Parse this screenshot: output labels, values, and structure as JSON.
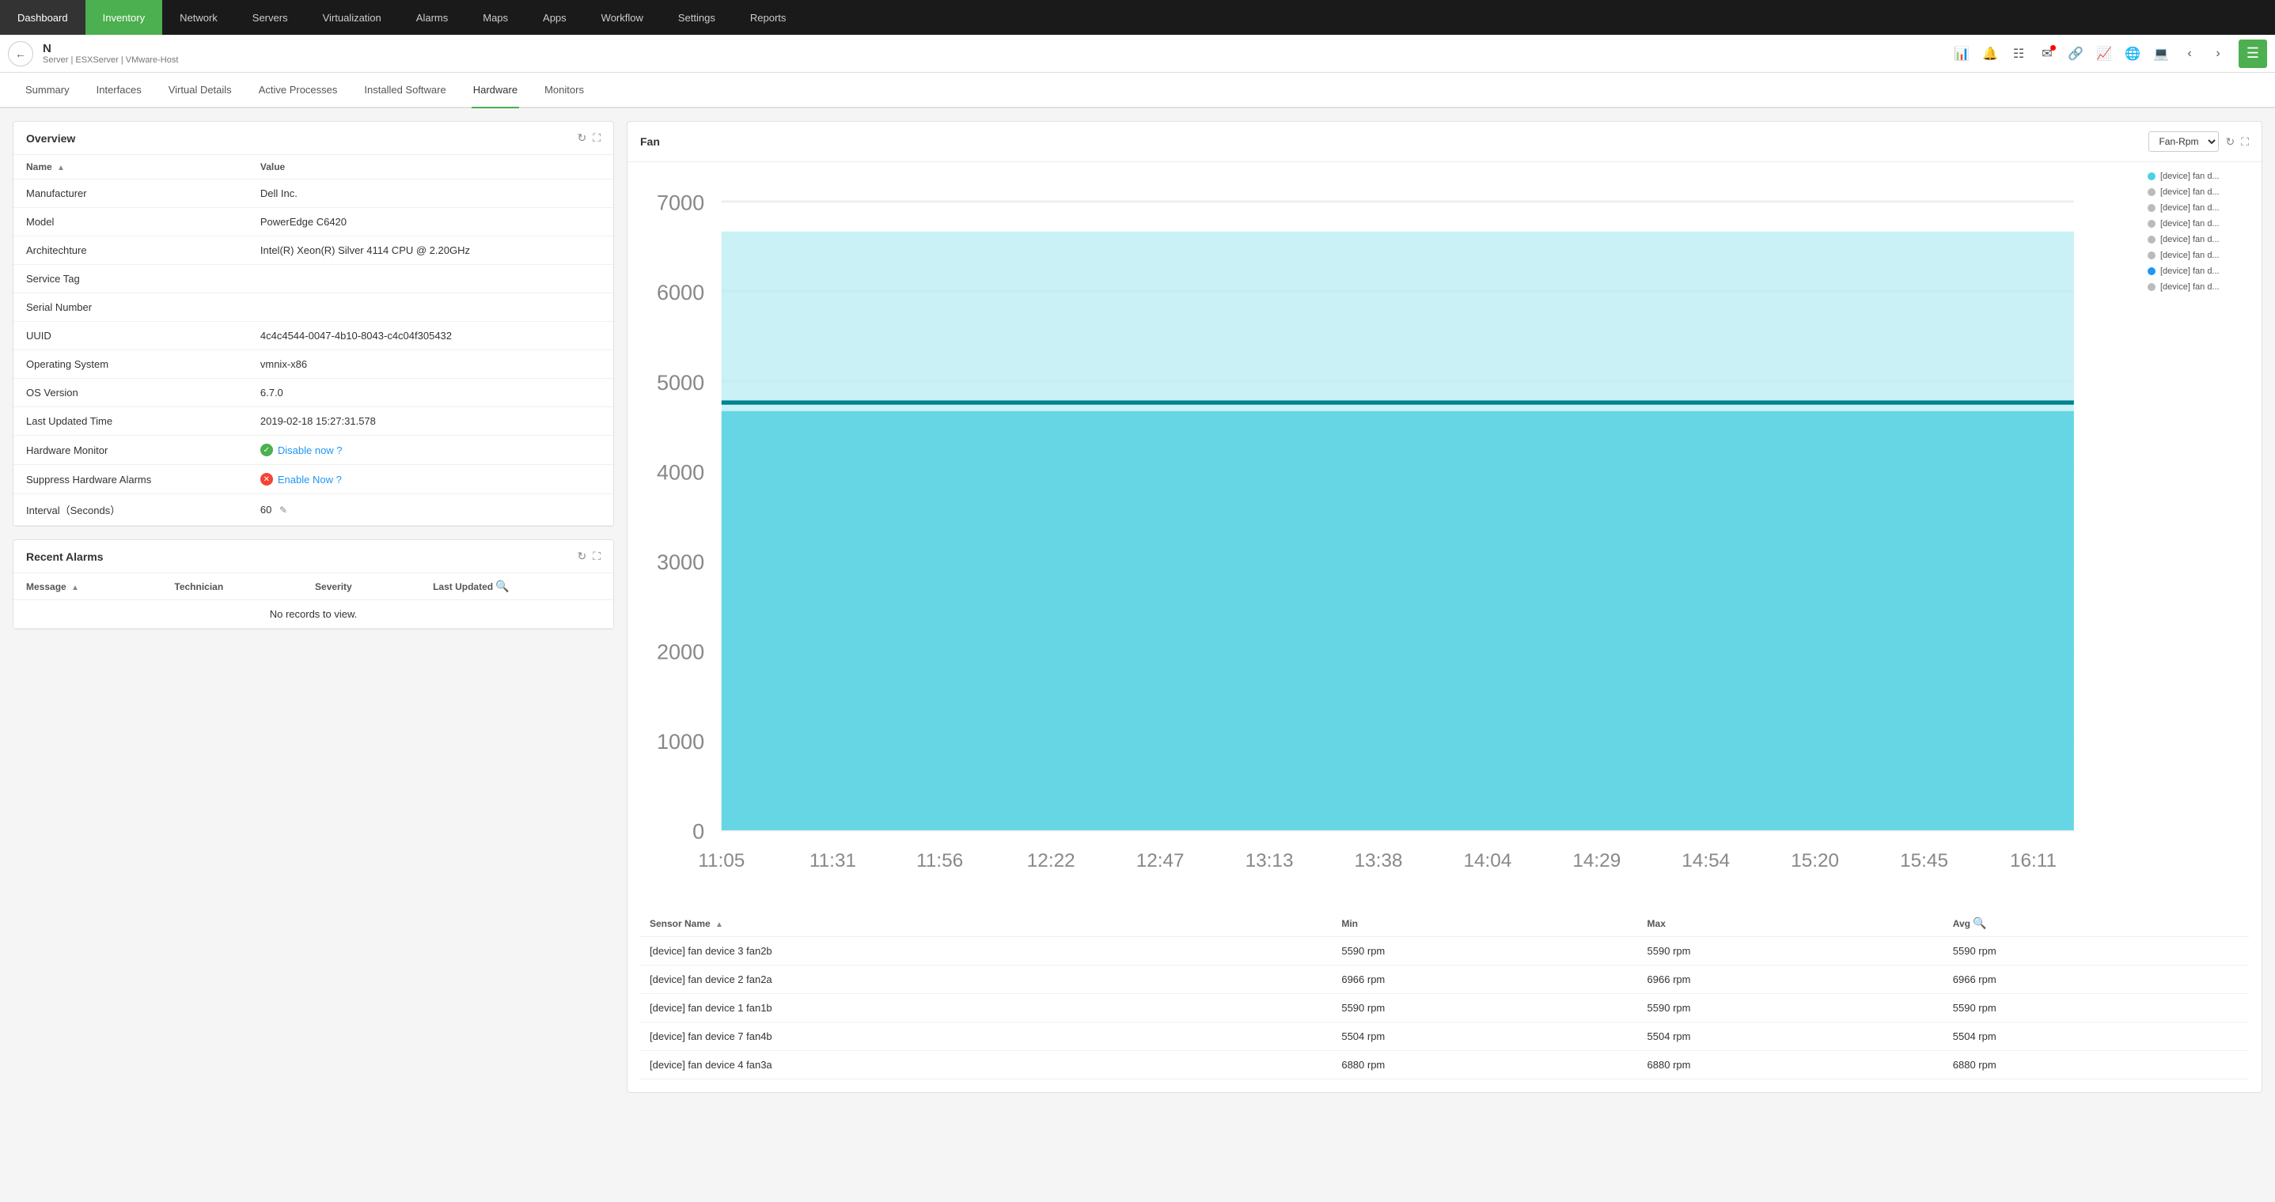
{
  "topNav": {
    "items": [
      {
        "label": "Dashboard",
        "active": false
      },
      {
        "label": "Inventory",
        "active": true
      },
      {
        "label": "Network",
        "active": false
      },
      {
        "label": "Servers",
        "active": false
      },
      {
        "label": "Virtualization",
        "active": false
      },
      {
        "label": "Alarms",
        "active": false
      },
      {
        "label": "Maps",
        "active": false
      },
      {
        "label": "Apps",
        "active": false
      },
      {
        "label": "Workflow",
        "active": false
      },
      {
        "label": "Settings",
        "active": false
      },
      {
        "label": "Reports",
        "active": false
      }
    ]
  },
  "breadcrumb": {
    "title": "N",
    "sub": "Server | ESXServer | VMware-Host"
  },
  "tabs": [
    {
      "label": "Summary",
      "active": false
    },
    {
      "label": "Interfaces",
      "active": false
    },
    {
      "label": "Virtual Details",
      "active": false
    },
    {
      "label": "Active Processes",
      "active": false
    },
    {
      "label": "Installed Software",
      "active": false
    },
    {
      "label": "Hardware",
      "active": true
    },
    {
      "label": "Monitors",
      "active": false
    }
  ],
  "overview": {
    "title": "Overview",
    "nameCol": "Name",
    "valueCol": "Value",
    "rows": [
      {
        "name": "Manufacturer",
        "value": "Dell Inc."
      },
      {
        "name": "Model",
        "value": "PowerEdge C6420"
      },
      {
        "name": "Architechture",
        "value": "Intel(R) Xeon(R) Silver 4114 CPU @ 2.20GHz"
      },
      {
        "name": "Service Tag",
        "value": ""
      },
      {
        "name": "Serial Number",
        "value": ""
      },
      {
        "name": "UUID",
        "value": "4c4c4544-0047-4b10-8043-c4c04f305432"
      },
      {
        "name": "Operating System",
        "value": "vmnix-x86"
      },
      {
        "name": "OS Version",
        "value": "6.7.0"
      },
      {
        "name": "Last Updated Time",
        "value": "2019-02-18 15:27:31.578"
      },
      {
        "name": "Hardware Monitor",
        "value": "",
        "special": "disable"
      },
      {
        "name": "Suppress Hardware Alarms",
        "value": "",
        "special": "enable"
      },
      {
        "name": "Interval（Seconds）",
        "value": "60",
        "special": "edit"
      }
    ]
  },
  "recentAlarms": {
    "title": "Recent Alarms",
    "columns": [
      "Message",
      "Technician",
      "Severity",
      "Last Updated"
    ],
    "noRecordsText": "No records to view.",
    "rows": []
  },
  "fan": {
    "title": "Fan",
    "dropdownLabel": "Fan-Rpm",
    "chartYLabels": [
      "7000",
      "6000",
      "5000",
      "4000",
      "3000",
      "2000",
      "1000",
      "0"
    ],
    "chartXLabels": [
      "11:05",
      "11:31",
      "11:56",
      "12:22",
      "12:47",
      "13:13",
      "13:38",
      "14:04",
      "14:29",
      "14:54",
      "15:20",
      "15:45",
      "16:11"
    ],
    "legend": [
      {
        "label": "[device] fan d...",
        "color": "#4dd0e1",
        "filled": true
      },
      {
        "label": "[device] fan d...",
        "color": "#bbb",
        "filled": false
      },
      {
        "label": "[device] fan d...",
        "color": "#bbb",
        "filled": false
      },
      {
        "label": "[device] fan d...",
        "color": "#bbb",
        "filled": false
      },
      {
        "label": "[device] fan d...",
        "color": "#bbb",
        "filled": false
      },
      {
        "label": "[device] fan d...",
        "color": "#bbb",
        "filled": false
      },
      {
        "label": "[device] fan d...",
        "color": "#2196f3",
        "filled": true
      },
      {
        "label": "[device] fan d...",
        "color": "#bbb",
        "filled": false
      }
    ],
    "sensorColumns": [
      "Sensor Name",
      "Min",
      "Max",
      "Avg"
    ],
    "sensorRows": [
      {
        "name": "[device] fan device 3 fan2b",
        "min": "5590 rpm",
        "max": "5590 rpm",
        "avg": "5590 rpm"
      },
      {
        "name": "[device] fan device 2 fan2a",
        "min": "6966 rpm",
        "max": "6966 rpm",
        "avg": "6966 rpm"
      },
      {
        "name": "[device] fan device 1 fan1b",
        "min": "5590 rpm",
        "max": "5590 rpm",
        "avg": "5590 rpm"
      },
      {
        "name": "[device] fan device 7 fan4b",
        "min": "5504 rpm",
        "max": "5504 rpm",
        "avg": "5504 rpm"
      },
      {
        "name": "[device] fan device 4 fan3a",
        "min": "6880 rpm",
        "max": "6880 rpm",
        "avg": "6880 rpm"
      }
    ]
  }
}
